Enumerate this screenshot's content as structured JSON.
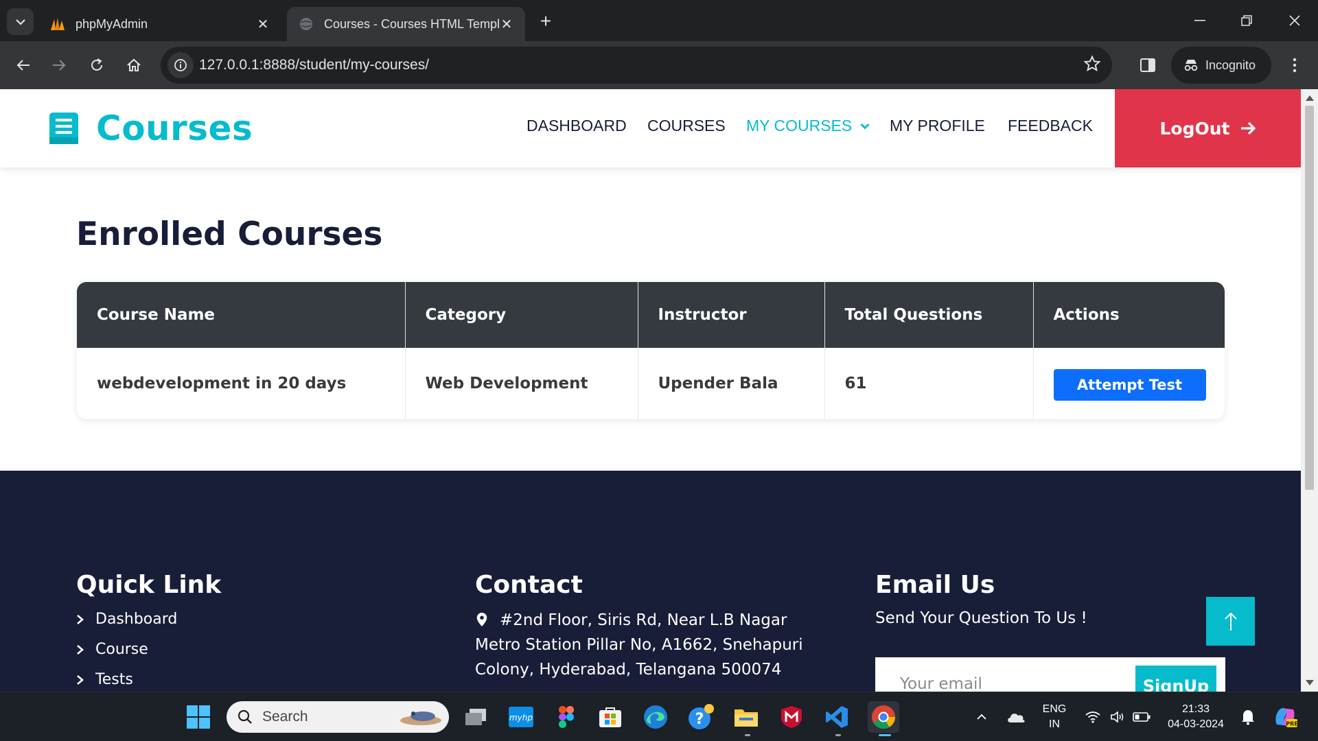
{
  "browser": {
    "tabs": [
      {
        "title": "phpMyAdmin",
        "active": false
      },
      {
        "title": "Courses - Courses HTML Templ",
        "active": true
      }
    ],
    "url": "127.0.0.1:8888/student/my-courses/",
    "profile_label": "Incognito"
  },
  "site": {
    "brand": "Courses",
    "brand_color": "#06BBCC",
    "nav": [
      "DASHBOARD",
      "COURSES",
      "MY COURSES",
      "MY PROFILE",
      "FEEDBACK"
    ],
    "active_nav": "MY COURSES",
    "logout_label": "LogOut",
    "logout_color": "#E0344B"
  },
  "main": {
    "title": "Enrolled Courses",
    "table": {
      "headers": [
        "Course Name",
        "Category",
        "Instructor",
        "Total Questions",
        "Actions"
      ],
      "rows": [
        {
          "course": "webdevelopment in 20 days",
          "category": "Web Development",
          "instructor": "Upender Bala",
          "total_questions": "61",
          "action": "Attempt Test"
        }
      ]
    }
  },
  "footer": {
    "quick_link_title": "Quick Link",
    "links": [
      "Dashboard",
      "Course",
      "Tests"
    ],
    "contact_title": "Contact",
    "address": "#2nd Floor, Siris Rd, Near L.B Nagar Metro Station Pillar No, A1662, Snehapuri Colony, Hyderabad, Telangana 500074",
    "email_title": "Email Us",
    "email_prompt": "Send Your Question To Us !",
    "email_placeholder": "Your email",
    "signup_label": "SignUp"
  },
  "taskbar": {
    "search_placeholder": "Search",
    "language": "ENG",
    "region": "IN",
    "time": "21:33",
    "date": "04-03-2024"
  }
}
